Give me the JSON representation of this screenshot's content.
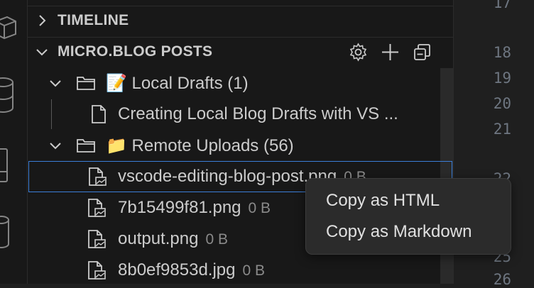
{
  "sidebar": {
    "sections": {
      "timeline": {
        "title": "TIMELINE"
      },
      "microblog": {
        "title": "MICRO.BLOG POSTS",
        "actions": {
          "settings_icon": "gear-icon",
          "add_icon": "plus-icon",
          "collapse_icon": "collapse-all-icon"
        },
        "tree": {
          "local_drafts": {
            "label": "📝 Local Drafts (1)"
          },
          "draft_item": {
            "label": "Creating Local Blog Drafts with VS ..."
          },
          "remote_uploads": {
            "label": "📁 Remote Uploads (56)"
          },
          "uploads": [
            {
              "name": "vscode-editing-blog-post.png",
              "size": "0 B"
            },
            {
              "name": "7b15499f81.png",
              "size": "0 B"
            },
            {
              "name": "output.png",
              "size": "0 B"
            },
            {
              "name": "8b0ef9853d.jpg",
              "size": "0 B"
            }
          ]
        }
      }
    }
  },
  "editor": {
    "line_numbers": [
      "17",
      "18",
      "19",
      "20",
      "21",
      "22",
      "25",
      "26"
    ]
  },
  "context_menu": {
    "items": [
      "Copy as HTML",
      "Copy as Markdown"
    ]
  },
  "colors": {
    "background": "#181818",
    "selection_border": "#3b7ed8",
    "menu_background": "#2b2b2b"
  }
}
